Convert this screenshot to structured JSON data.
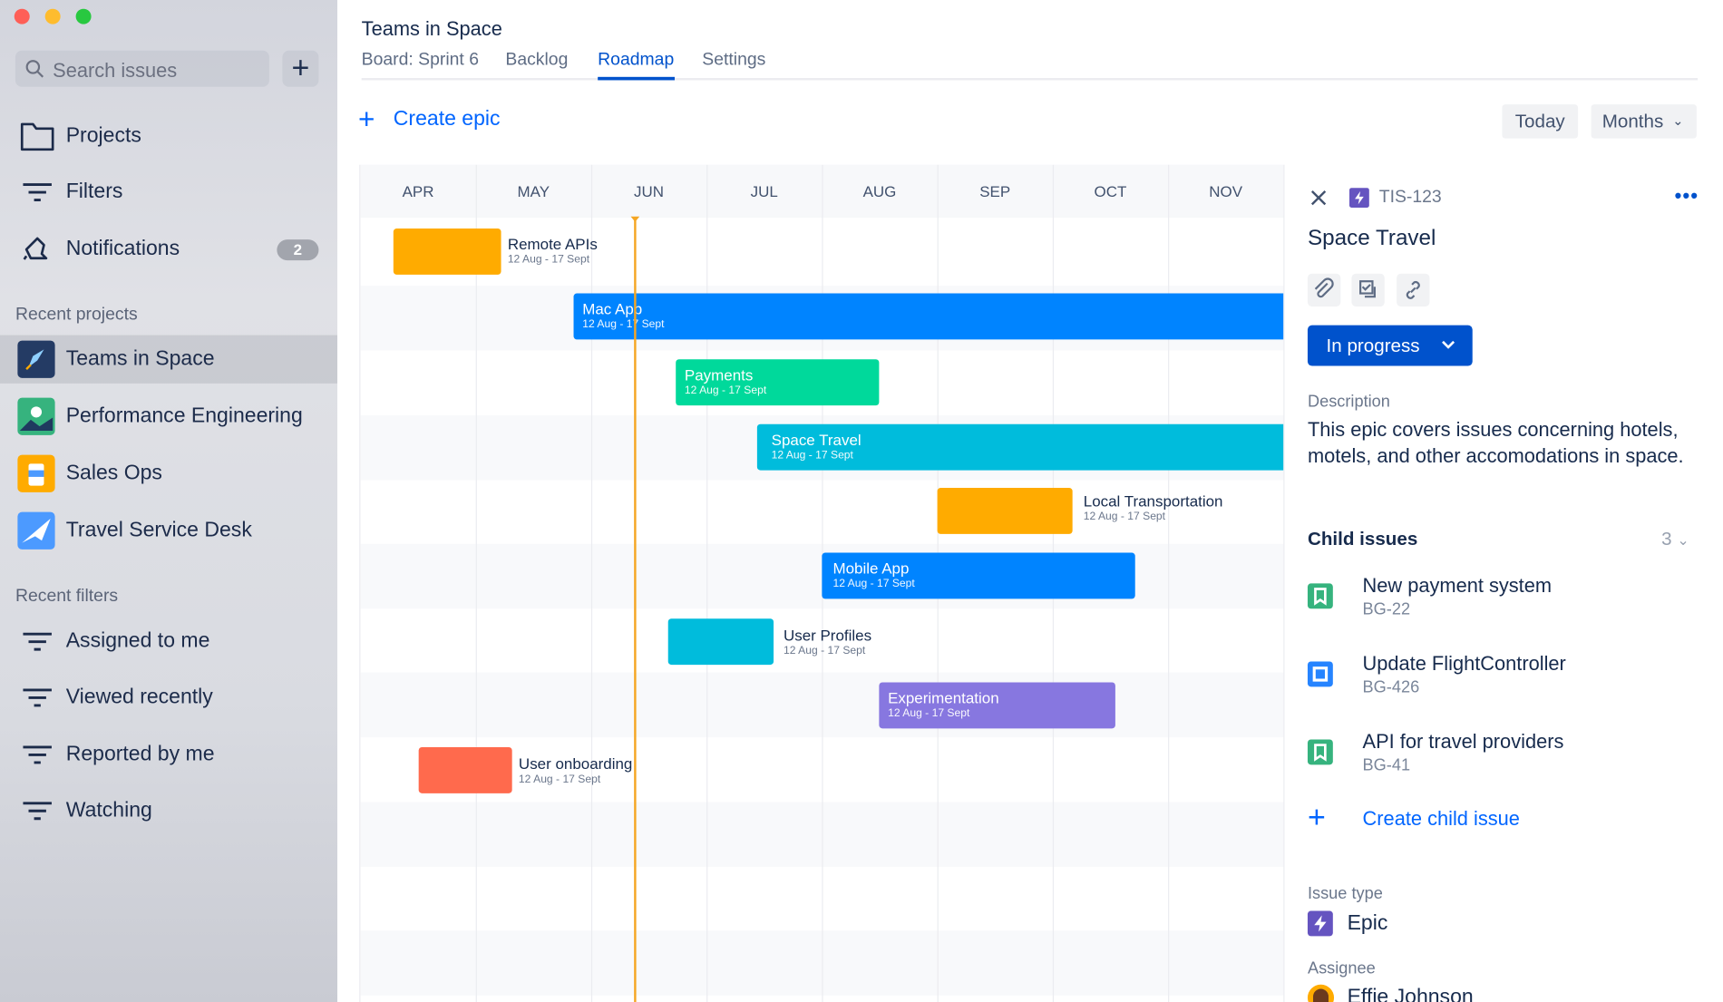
{
  "window": {
    "traffic_lights": [
      "#fe5f57",
      "#febc2e",
      "#28c840"
    ]
  },
  "sidebar": {
    "search_placeholder": "Search issues",
    "add_label": "+",
    "nav": [
      {
        "label": "Projects",
        "icon": "folder-icon"
      },
      {
        "label": "Filters",
        "icon": "filter-icon"
      },
      {
        "label": "Notifications",
        "icon": "bell-icon",
        "badge": "2"
      }
    ],
    "recent_projects_heading": "Recent projects",
    "recent_projects": [
      {
        "label": "Teams in Space",
        "selected": true
      },
      {
        "label": "Performance Engineering"
      },
      {
        "label": "Sales Ops"
      },
      {
        "label": "Travel Service Desk"
      }
    ],
    "recent_filters_heading": "Recent filters",
    "recent_filters": [
      {
        "label": "Assigned to me"
      },
      {
        "label": "Viewed recently"
      },
      {
        "label": "Reported by me"
      },
      {
        "label": "Watching"
      }
    ]
  },
  "header": {
    "title": "Teams in Space",
    "tabs": [
      {
        "label": "Board: Sprint 6"
      },
      {
        "label": "Backlog"
      },
      {
        "label": "Roadmap",
        "active": true
      },
      {
        "label": "Settings"
      }
    ]
  },
  "toolbar": {
    "create_epic": "Create epic",
    "today": "Today",
    "months": "Months"
  },
  "roadmap": {
    "months": [
      "APR",
      "MAY",
      "JUN",
      "JUL",
      "AUG",
      "SEP",
      "OCT",
      "NOV"
    ],
    "epics": [
      {
        "name": "Remote APIs",
        "dates": "12 Aug - 17 Sept",
        "color": "#ffab00"
      },
      {
        "name": "Mac App",
        "dates": "12 Aug - 17 Sept",
        "color": "#0084ff"
      },
      {
        "name": "Payments",
        "dates": "12 Aug - 17 Sept",
        "color": "#00d99b"
      },
      {
        "name": "Space Travel",
        "dates": "12 Aug - 17 Sept",
        "color": "#00bcdc"
      },
      {
        "name": "Local Transportation",
        "dates": "12 Aug - 17 Sept",
        "color": "#ffab00"
      },
      {
        "name": "Mobile App",
        "dates": "12 Aug - 17 Sept",
        "color": "#0084ff"
      },
      {
        "name": "User Profiles",
        "dates": "12 Aug - 17 Sept",
        "color": "#00bcdc"
      },
      {
        "name": "Experimentation",
        "dates": "12 Aug - 17 Sept",
        "color": "#8777e0"
      },
      {
        "name": "User onboarding",
        "dates": "12 Aug - 17 Sept",
        "color": "#ff6a4d"
      }
    ],
    "today_color": "#f5a623"
  },
  "detail": {
    "key": "TIS-123",
    "title": "Space Travel",
    "status": "In progress",
    "description_label": "Description",
    "description": "This epic covers issues concerning hotels, motels, and other accomodations in space.",
    "child_issues_label": "Child issues",
    "child_count": "3",
    "children": [
      {
        "title": "New payment system",
        "key": "BG-22",
        "type": "story"
      },
      {
        "title": "Update FlightController",
        "key": "BG-426",
        "type": "task"
      },
      {
        "title": "API for travel providers",
        "key": "BG-41",
        "type": "story"
      }
    ],
    "create_child": "Create child issue",
    "issue_type_label": "Issue type",
    "issue_type": "Epic",
    "assignee_label": "Assignee",
    "assignee": "Effie Johnson"
  }
}
